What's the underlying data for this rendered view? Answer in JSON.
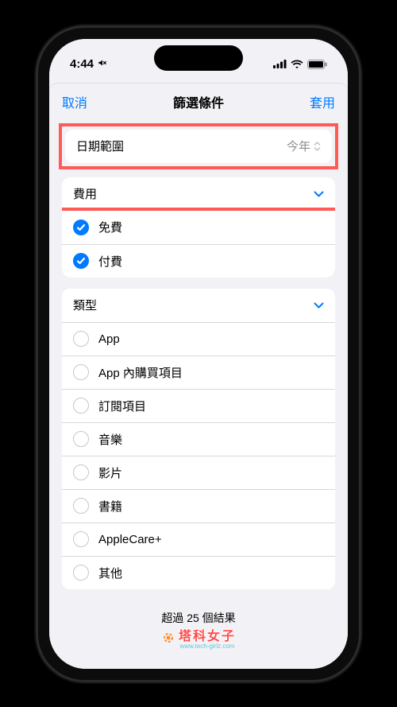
{
  "status": {
    "time": "4:44",
    "silent": true
  },
  "nav": {
    "cancel": "取消",
    "title": "篩選條件",
    "apply": "套用"
  },
  "dateRange": {
    "label": "日期範圍",
    "value": "今年"
  },
  "cost": {
    "header": "費用",
    "items": [
      {
        "label": "免費",
        "checked": true
      },
      {
        "label": "付費",
        "checked": true
      }
    ]
  },
  "type": {
    "header": "類型",
    "items": [
      {
        "label": "App"
      },
      {
        "label": "App 內購買項目"
      },
      {
        "label": "訂閱項目"
      },
      {
        "label": "音樂"
      },
      {
        "label": "影片"
      },
      {
        "label": "書籍"
      },
      {
        "label": "AppleCare+"
      },
      {
        "label": "其他"
      }
    ]
  },
  "footer": "超過 25 個結果",
  "watermark": {
    "brand": "塔科女子",
    "url": "www.tech-girlz.com"
  }
}
